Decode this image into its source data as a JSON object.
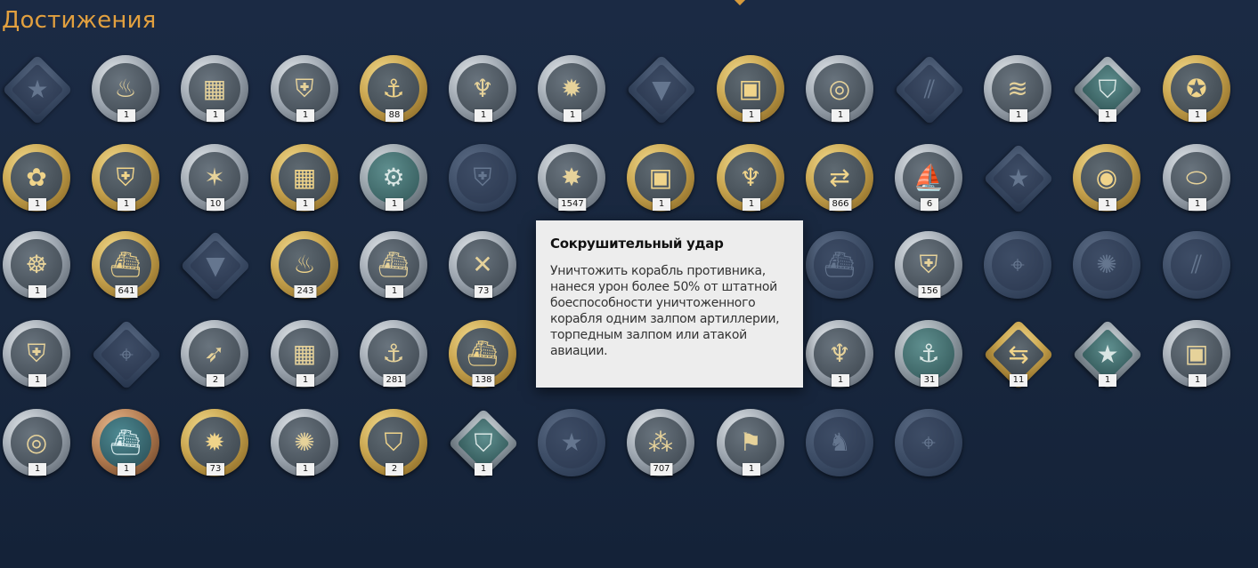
{
  "page": {
    "title": "Достижения"
  },
  "colors": {
    "background": "#1b2a44",
    "title": "#e2a03f",
    "tooltip_bg": "#ededed",
    "gold": "#c9a54f",
    "silver": "#9aa3ad",
    "dark": "#3a4a63"
  },
  "achievements": [
    [
      {
        "icon": "star-emblem-icon",
        "shape": "diamond",
        "tier": "dark",
        "count": ""
      },
      {
        "icon": "flames-icon",
        "shape": "circle",
        "tier": "silver",
        "count": "1"
      },
      {
        "icon": "fortress-wall-icon",
        "shape": "circle",
        "tier": "silver",
        "count": "1"
      },
      {
        "icon": "helmet-wreath-icon",
        "shape": "circle",
        "tier": "silver",
        "count": "1"
      },
      {
        "icon": "anchor-fire-icon",
        "shape": "circle",
        "tier": "gold",
        "count": "88"
      },
      {
        "icon": "winged-statue-icon",
        "shape": "circle",
        "tier": "silver",
        "count": "1"
      },
      {
        "icon": "explosion-icon",
        "shape": "circle",
        "tier": "silver",
        "count": "1"
      },
      {
        "icon": "triangle-emblem-icon",
        "shape": "diamond",
        "tier": "dark",
        "count": ""
      },
      {
        "icon": "supply-crate-icon",
        "shape": "circle",
        "tier": "gold",
        "count": "1"
      },
      {
        "icon": "silver-coins-icon",
        "shape": "circle",
        "tier": "silver",
        "count": "1"
      },
      {
        "icon": "torpedo-stripes-icon",
        "shape": "diamond",
        "tier": "dark",
        "count": ""
      },
      {
        "icon": "wave-ship-icon",
        "shape": "circle",
        "tier": "silver",
        "count": "1"
      },
      {
        "icon": "shield-emblem-icon",
        "shape": "diamond",
        "tier": "teal",
        "count": "1"
      },
      {
        "icon": "red-star-icon",
        "shape": "circle",
        "tier": "gold",
        "count": "1"
      }
    ],
    [
      {
        "icon": "key-flower-icon",
        "shape": "circle",
        "tier": "gold",
        "count": "1"
      },
      {
        "icon": "helmet-gold-icon",
        "shape": "circle",
        "tier": "gold",
        "count": "1"
      },
      {
        "icon": "starfish-icon",
        "shape": "circle",
        "tier": "silver",
        "count": "10"
      },
      {
        "icon": "fortress-gold-icon",
        "shape": "circle",
        "tier": "gold",
        "count": "1"
      },
      {
        "icon": "gear-bubbles-icon",
        "shape": "circle",
        "tier": "teal",
        "count": "1"
      },
      {
        "icon": "helmet-wreath-dark-icon",
        "shape": "circle",
        "tier": "dark",
        "count": ""
      },
      {
        "icon": "devastating-strike-icon",
        "shape": "circle",
        "tier": "silver",
        "count": "1547"
      },
      {
        "icon": "supply-crate-icon",
        "shape": "circle",
        "tier": "gold",
        "count": "1"
      },
      {
        "icon": "winged-statue-icon",
        "shape": "circle",
        "tier": "gold",
        "count": "1"
      },
      {
        "icon": "arrows-ship-icon",
        "shape": "circle",
        "tier": "gold",
        "count": "866"
      },
      {
        "icon": "sailing-ship-icon",
        "shape": "circle",
        "tier": "silver",
        "count": "6"
      },
      {
        "icon": "star-emblem-icon",
        "shape": "diamond",
        "tier": "dark",
        "count": ""
      },
      {
        "icon": "coin-stacks-icon",
        "shape": "circle",
        "tier": "gold",
        "count": "1"
      },
      {
        "icon": "airship-icon",
        "shape": "circle",
        "tier": "silver",
        "count": "1"
      }
    ],
    [
      {
        "icon": "kraken-icon",
        "shape": "circle",
        "tier": "silver",
        "count": "1"
      },
      {
        "icon": "battleship-wreath-icon",
        "shape": "circle",
        "tier": "gold",
        "count": "641"
      },
      {
        "icon": "triangle-emblem-icon",
        "shape": "diamond",
        "tier": "dark",
        "count": ""
      },
      {
        "icon": "burning-ship-icon",
        "shape": "circle",
        "tier": "gold",
        "count": "243"
      },
      {
        "icon": "cruiser-icon",
        "shape": "circle",
        "tier": "silver",
        "count": "1"
      },
      {
        "icon": "double-strike-icon",
        "shape": "circle",
        "tier": "silver",
        "count": "73"
      },
      {
        "icon": "hidden-icon",
        "shape": "circle",
        "tier": "silver",
        "count": ""
      },
      {
        "icon": "hidden-icon",
        "shape": "circle",
        "tier": "silver",
        "count": ""
      },
      {
        "icon": "hidden-icon",
        "shape": "circle",
        "tier": "silver",
        "count": ""
      },
      {
        "icon": "ship-bow-icon",
        "shape": "circle",
        "tier": "dark",
        "count": ""
      },
      {
        "icon": "green-shield-kraken-icon",
        "shape": "circle",
        "tier": "silver",
        "count": "156"
      },
      {
        "icon": "crosshair-icon",
        "shape": "circle",
        "tier": "dark",
        "count": ""
      },
      {
        "icon": "sunburst-icon",
        "shape": "circle",
        "tier": "dark",
        "count": ""
      },
      {
        "icon": "torpedo-launcher-icon",
        "shape": "circle",
        "tier": "dark",
        "count": ""
      }
    ],
    [
      {
        "icon": "helmet-silver-icon",
        "shape": "circle",
        "tier": "silver",
        "count": "1"
      },
      {
        "icon": "crosshair-icon",
        "shape": "diamond",
        "tier": "dark",
        "count": ""
      },
      {
        "icon": "arrow-rocks-icon",
        "shape": "circle",
        "tier": "silver",
        "count": "2"
      },
      {
        "icon": "fortress-wall-icon",
        "shape": "circle",
        "tier": "silver",
        "count": "1"
      },
      {
        "icon": "anchor-icon",
        "shape": "circle",
        "tier": "silver",
        "count": "281"
      },
      {
        "icon": "ship-wreath-icon",
        "shape": "circle",
        "tier": "gold",
        "count": "138"
      },
      {
        "icon": "hidden-icon",
        "shape": "circle",
        "tier": "silver",
        "count": ""
      },
      {
        "icon": "hidden-icon",
        "shape": "circle",
        "tier": "silver",
        "count": ""
      },
      {
        "icon": "hidden-icon",
        "shape": "circle",
        "tier": "silver",
        "count": ""
      },
      {
        "icon": "winged-statue-icon",
        "shape": "circle",
        "tier": "silver",
        "count": "1"
      },
      {
        "icon": "anchor-bubbles-icon",
        "shape": "circle",
        "tier": "teal",
        "count": "31"
      },
      {
        "icon": "arrows-diamond-icon",
        "shape": "diamond",
        "tier": "gold",
        "count": "11"
      },
      {
        "icon": "star-emblem-icon",
        "shape": "diamond",
        "tier": "teal",
        "count": "1"
      },
      {
        "icon": "crane-crate-icon",
        "shape": "circle",
        "tier": "silver",
        "count": "1"
      }
    ],
    [
      {
        "icon": "silver-coins-icon",
        "shape": "circle",
        "tier": "silver",
        "count": "1"
      },
      {
        "icon": "ship-emblem-icon",
        "shape": "circle",
        "tier": "bronze",
        "count": "1"
      },
      {
        "icon": "ship-explosion-icon",
        "shape": "circle",
        "tier": "gold",
        "count": "73"
      },
      {
        "icon": "medal-burst-icon",
        "shape": "circle",
        "tier": "silver",
        "count": "1"
      },
      {
        "icon": "shield-arrows-icon",
        "shape": "circle",
        "tier": "gold",
        "count": "2"
      },
      {
        "icon": "shield-emblem-icon",
        "shape": "diamond",
        "tier": "teal",
        "count": "1"
      },
      {
        "icon": "star-wreath-icon",
        "shape": "circle",
        "tier": "dark",
        "count": ""
      },
      {
        "icon": "shells-icon",
        "shape": "circle",
        "tier": "silver",
        "count": "707"
      },
      {
        "icon": "flag-icon",
        "shape": "circle",
        "tier": "silver",
        "count": "1"
      },
      {
        "icon": "fox-icon",
        "shape": "circle",
        "tier": "dark",
        "count": ""
      },
      {
        "icon": "crosshair-icon",
        "shape": "circle",
        "tier": "dark",
        "count": ""
      }
    ]
  ],
  "tooltip": {
    "title": "Сокрушительный удар",
    "body": "Уничтожить корабль противника, нанеся урон более 50% от штатной боеспособности уничтоженного корабля одним залпом артиллерии, торпедным залпом или атакой авиации."
  }
}
